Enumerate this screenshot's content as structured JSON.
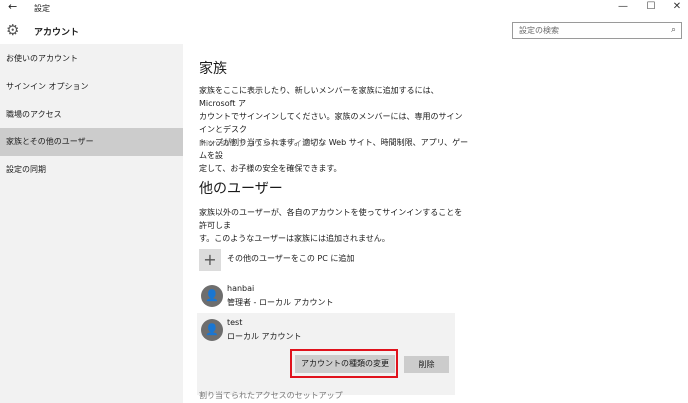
{
  "window": {
    "title": "設定",
    "back_glyph": "←",
    "minimize_glyph": "—",
    "maximize_glyph": "☐",
    "close_glyph": "✕"
  },
  "header": {
    "title": "アカウント",
    "gear_glyph": "⚙",
    "search_placeholder": "設定の検索",
    "search_glyph": "⌕"
  },
  "sidebar": {
    "items": [
      {
        "label": "お使いのアカウント",
        "active": false
      },
      {
        "label": "サインイン オプション",
        "active": false
      },
      {
        "label": "職場のアクセス",
        "active": false
      },
      {
        "label": "家族とその他のユーザー",
        "active": true
      },
      {
        "label": "設定の同期",
        "active": false
      }
    ]
  },
  "main": {
    "family": {
      "heading": "家族",
      "desc_line1": "家族をここに表示したり、新しいメンバーを家族に追加するには、Microsoft ア",
      "desc_line2": "カウントでサインインしてください。家族のメンバーには、専用のサインインとデスク",
      "desc_line3": "トップが割り当てられます。適切な Web サイト、時間制限、アプリ、ゲームを設",
      "desc_line4": "定して、お子様の安全を確保できます。",
      "signin_link": "Microsoft アカウントでサインイン"
    },
    "other_users": {
      "heading": "他のユーザー",
      "desc_line1": "家族以外のユーザーが、各自のアカウントを使ってサインインすることを許可しま",
      "desc_line2": "す。このようなユーザーは家族には追加されません。",
      "add_glyph": "+",
      "add_label": "その他のユーザーをこの PC に追加",
      "users": [
        {
          "name": "hanbai",
          "role": "管理者 - ローカル アカウント"
        },
        {
          "name": "test",
          "role": "ローカル アカウント"
        }
      ],
      "avatar_glyph": "👤",
      "change_type_button": "アカウントの種類の変更",
      "delete_button": "削除",
      "assigned_access_link": "割り当てられたアクセスのセットアップ"
    }
  },
  "colors": {
    "sidebar_bg": "#f2f2f2",
    "sidebar_active": "#cccccc",
    "highlight_border": "#e0121c",
    "button_bg": "#cccccc",
    "avatar_bg": "#6e6e6e"
  }
}
